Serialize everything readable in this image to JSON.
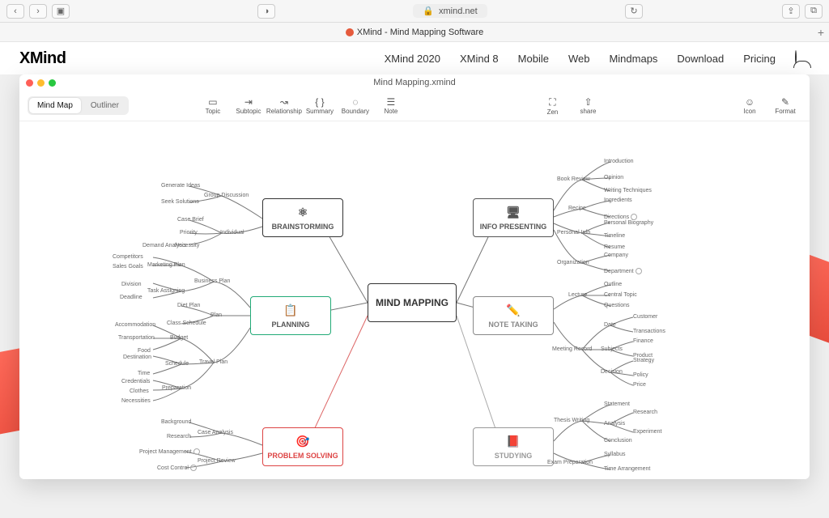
{
  "browser": {
    "domain": "xmind.net",
    "tab_title": "XMind - Mind Mapping Software"
  },
  "site": {
    "logo": "XMind",
    "nav": [
      "XMind 2020",
      "XMind 8",
      "Mobile",
      "Web",
      "Mindmaps",
      "Download",
      "Pricing"
    ]
  },
  "app": {
    "filename": "Mind Mapping.xmind",
    "views": {
      "mindmap": "Mind Map",
      "outliner": "Outliner"
    },
    "tools": {
      "topic": "Topic",
      "subtopic": "Subtopic",
      "relationship": "Relationship",
      "summary": "Summary",
      "boundary": "Boundary",
      "note": "Note",
      "zen": "Zen",
      "share": "share",
      "icon": "Icon",
      "format": "Format"
    }
  },
  "map": {
    "center": "MIND MAPPING",
    "brainstorming": {
      "label": "BRAINSTORMING",
      "group_discussion": "Group Discussion",
      "generate_ideas": "Generate Ideas",
      "seek_solutions": "Seek Solutions",
      "individual": "Individual",
      "case_brief": "Case Brief",
      "priority": "Priority",
      "necessity": "Necessity",
      "demand_analysis": "Demand Analysis"
    },
    "planning": {
      "label": "PLANNING",
      "business_plan": "Business Plan",
      "marketing_plan": "Marketing Plan",
      "competitors": "Competitors",
      "sales_goals": "Sales Goals",
      "division": "Division",
      "deadline": "Deadline",
      "task_assigning": "Task Assigning",
      "plan": "Plan",
      "diet_plan": "Diet Plan",
      "class_schedule": "Class Schedule",
      "travel_plan": "Travel Plan",
      "budget": "Budget",
      "accommodation": "Accommodation",
      "transportation": "Transportation",
      "food": "Food",
      "schedule": "Schedule",
      "destination": "Destination",
      "time": "Time",
      "preparation": "Preparation",
      "credentials": "Credentials",
      "clothes": "Clothes",
      "necessities": "Necessities"
    },
    "problem": {
      "label": "PROBLEM SOLVING",
      "case_analysis": "Case Analysis",
      "background": "Background",
      "research": "Research",
      "project_review": "Project Review",
      "project_management": "Project Management",
      "cost_control": "Cost Control"
    },
    "info": {
      "label": "INFO PRESENTING",
      "book_review": "Book Review",
      "introduction": "Introduction",
      "opinion": "Opinion",
      "writing_techniques": "Writing Techniques",
      "recipe": "Recipe",
      "ingredients": "Ingredients",
      "directions": "Directions",
      "personal_info": "Personal Info",
      "personal_biography": "Personal Biography",
      "timeline": "Timeline",
      "resume": "Resume",
      "organization": "Organization",
      "company": "Company",
      "department": "Department"
    },
    "note": {
      "label": "NOTE TAKING",
      "lecture": "Lecture",
      "outline": "Outline",
      "central_topic": "Central Topic",
      "questions": "Questions",
      "meeting_record": "Meeting Record",
      "date": "Date",
      "customer": "Customer",
      "transactions": "Transactions",
      "subjects": "Subjects",
      "finance": "Finance",
      "product": "Product",
      "decision": "Decision",
      "strategy": "Strategy",
      "policy": "Policy",
      "price": "Price"
    },
    "study": {
      "label": "STUDYING",
      "thesis_writing": "Thesis Writing",
      "statement": "Statement",
      "analysis": "Analysis",
      "research": "Research",
      "experiment": "Experiment",
      "conclusion": "Conclusion",
      "exam_preparation": "Exam Preparation",
      "syllabus": "Syllabus",
      "time_arrangement": "Time Arrangement"
    }
  }
}
